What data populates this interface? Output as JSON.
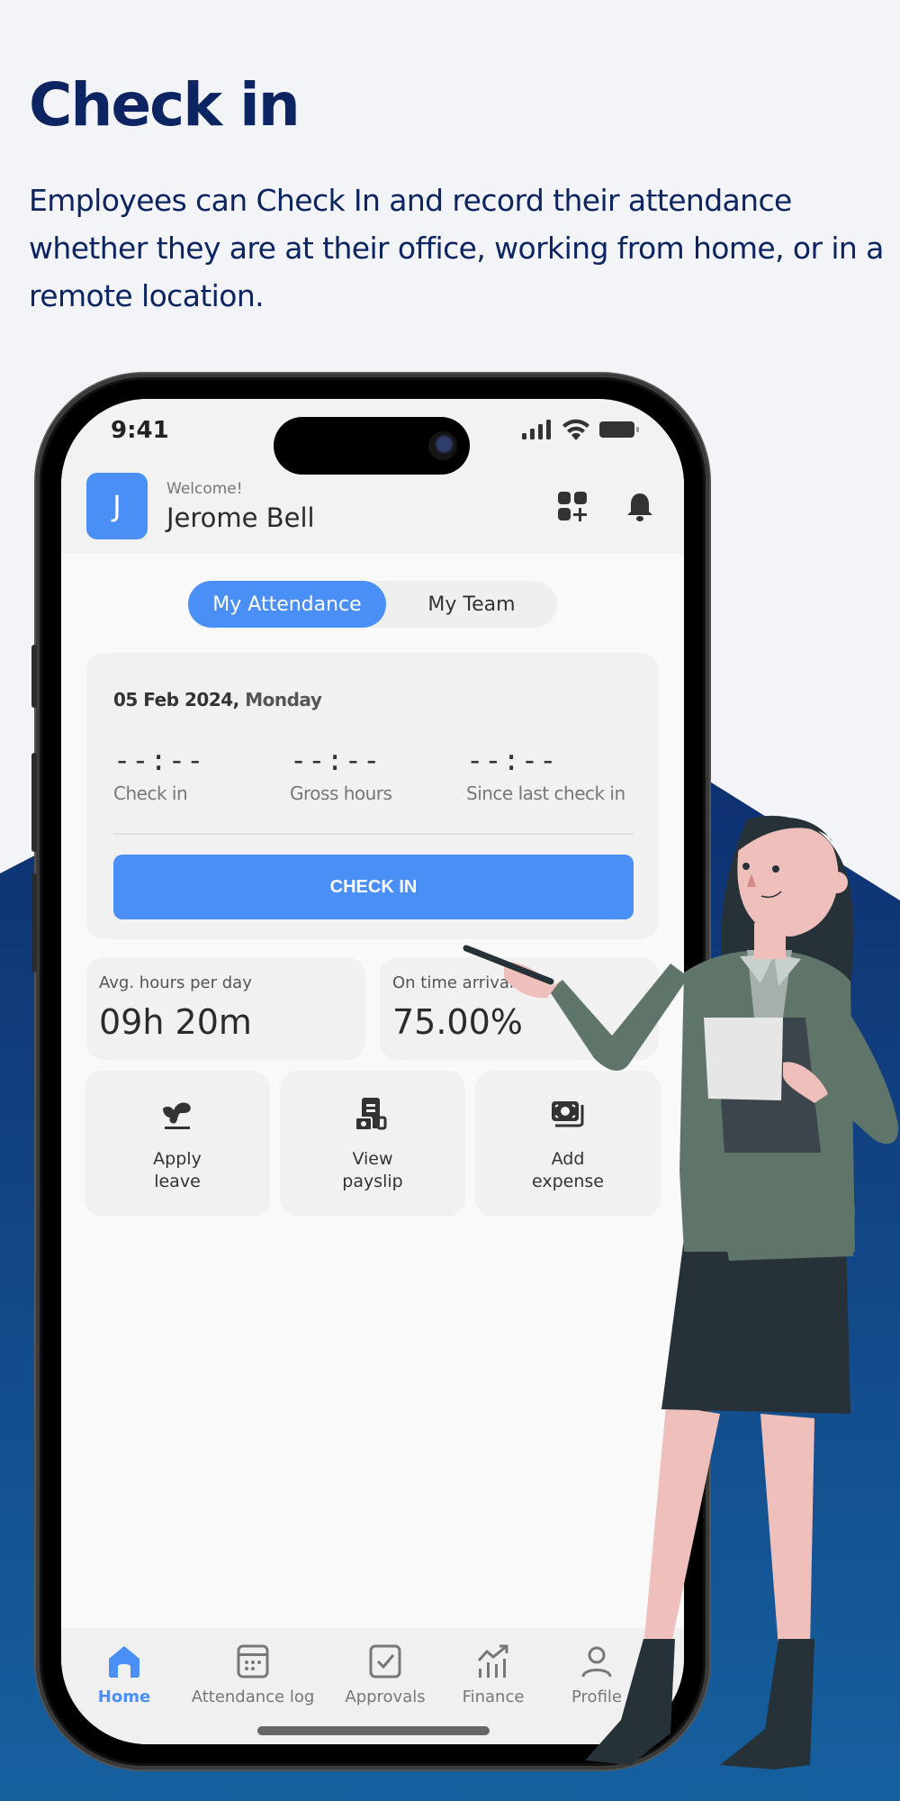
{
  "marketing": {
    "headline": "Check in",
    "description": "Employees can Check In and record their attendance whether they are at their office, working from home, or in a remote location."
  },
  "colors": {
    "accent": "#4a8ff5",
    "headline": "#0c2461",
    "background_shape_top": "#0d2a6b",
    "background_shape_bottom": "#16609f"
  },
  "status_bar": {
    "time": "9:41",
    "icons": [
      "signal-icon",
      "wifi-icon",
      "battery-icon"
    ]
  },
  "header": {
    "avatar_initial": "J",
    "welcome_text": "Welcome!",
    "user_name": "Jerome Bell",
    "icons": [
      "add-widget-icon",
      "bell-icon"
    ]
  },
  "segmented_control": {
    "options": [
      {
        "label": "My Attendance",
        "selected": true
      },
      {
        "label": "My Team",
        "selected": false
      }
    ]
  },
  "attendance_card": {
    "date": "05 Feb 2024,",
    "day": "Monday",
    "metrics": [
      {
        "value": "--:--",
        "label": "Check in"
      },
      {
        "value": "--:--",
        "label": "Gross hours"
      },
      {
        "value": "--:--",
        "label": "Since last check in"
      }
    ],
    "button_label": "CHECK IN"
  },
  "stats": [
    {
      "label": "Avg. hours per day",
      "value": "09h 20m"
    },
    {
      "label": "On time arrival",
      "value": "75.00%"
    }
  ],
  "actions": [
    {
      "label_line1": "Apply",
      "label_line2": "leave",
      "icon": "beach-icon"
    },
    {
      "label_line1": "View",
      "label_line2": "payslip",
      "icon": "payslip-icon"
    },
    {
      "label_line1": "Add",
      "label_line2": "expense",
      "icon": "cash-icon"
    }
  ],
  "tabbar": {
    "items": [
      {
        "label": "Home",
        "icon": "home-icon",
        "active": true
      },
      {
        "label": "Attendance log",
        "icon": "calendar-icon",
        "active": false
      },
      {
        "label": "Approvals",
        "icon": "checkbox-icon",
        "active": false
      },
      {
        "label": "Finance",
        "icon": "chart-up-icon",
        "active": false
      },
      {
        "label": "Profile",
        "icon": "user-icon",
        "active": false
      }
    ]
  }
}
